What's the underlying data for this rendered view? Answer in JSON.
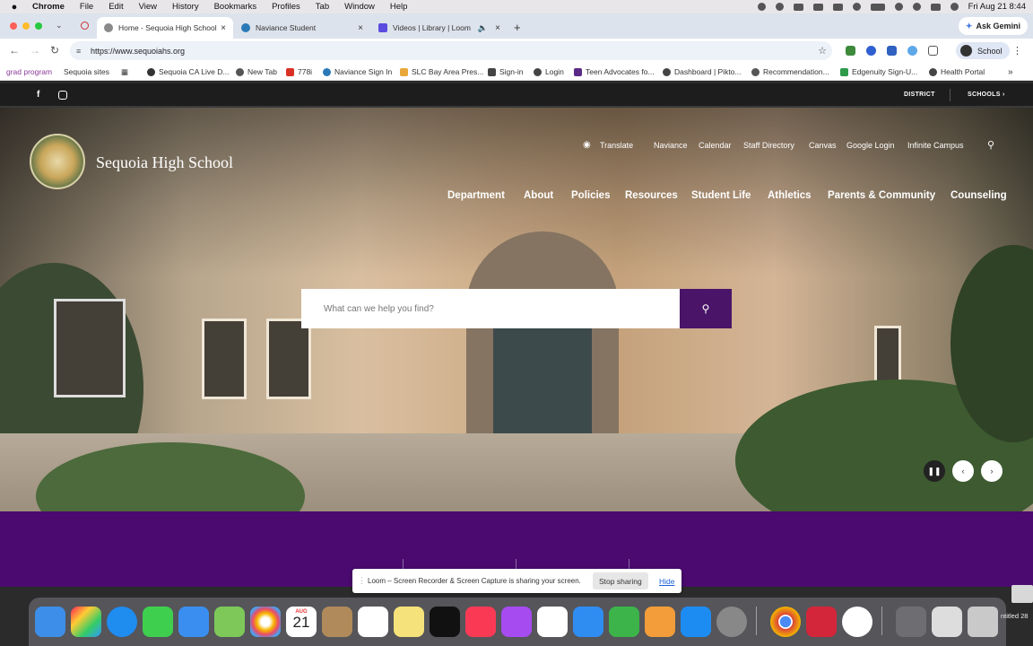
{
  "menubar": {
    "app": "Chrome",
    "items": [
      "File",
      "Edit",
      "View",
      "History",
      "Bookmarks",
      "Profiles",
      "Tab",
      "Window",
      "Help"
    ],
    "clock": "Fri Aug 21  8:44"
  },
  "tabs": [
    {
      "title": "Home - Sequoia High School",
      "color": "#8a8a8a"
    },
    {
      "title": "Naviance Student",
      "color": "#2a7ab8"
    },
    {
      "title": "Videos | Library | Loom",
      "color": "#5a4ce0"
    }
  ],
  "ask_gemini": "Ask Gemini",
  "address": {
    "url": "https://www.sequoiahs.org",
    "profile": "School"
  },
  "bookmarks": [
    {
      "label": "grad program",
      "color": "#8b3a9a",
      "textcolor": "#8b3a9a"
    },
    {
      "label": "Sequoia sites",
      "color": "",
      "textcolor": "#333"
    },
    {
      "label": "Sequoia CA Live D...",
      "color": "#333",
      "textcolor": "#333"
    },
    {
      "label": "New Tab",
      "color": "#555",
      "textcolor": "#333"
    },
    {
      "label": "778i",
      "color": "#d93025",
      "textcolor": "#333"
    },
    {
      "label": "Naviance Sign In",
      "color": "#2a7ab8",
      "textcolor": "#333"
    },
    {
      "label": "SLC Bay Area Pres...",
      "color": "#e8a93a",
      "textcolor": "#333"
    },
    {
      "label": "Sign-in",
      "color": "#444",
      "textcolor": "#333"
    },
    {
      "label": "Login",
      "color": "#444",
      "textcolor": "#333"
    },
    {
      "label": "Teen Advocates fo...",
      "color": "#5b2a86",
      "textcolor": "#333"
    },
    {
      "label": "Dashboard | Pikto...",
      "color": "#444",
      "textcolor": "#333"
    },
    {
      "label": "Recommendation...",
      "color": "#555",
      "textcolor": "#333"
    },
    {
      "label": "Edgenuity Sign-U...",
      "color": "#2e9a4a",
      "textcolor": "#333"
    },
    {
      "label": "Health Portal",
      "color": "#444",
      "textcolor": "#333"
    }
  ],
  "site": {
    "top_links": {
      "district": "DISTRICT",
      "schools": "SCHOOLS ›"
    },
    "name": "Sequoia High School",
    "utility": [
      "Translate",
      "Naviance",
      "Calendar",
      "Staff Directory",
      "Canvas",
      "Google Login",
      "Infinite Campus"
    ],
    "nav": [
      "Department",
      "About",
      "Policies",
      "Resources",
      "Student Life",
      "Athletics",
      "Parents & Community",
      "Counseling"
    ],
    "search_placeholder": "What can we help you find?",
    "purple": "#4a0a6f"
  },
  "loom": {
    "message": "Loom – Screen Recorder & Screen Capture is sharing your screen.",
    "stop": "Stop sharing",
    "hide": "Hide"
  },
  "calendar": {
    "month": "AUG",
    "day": "21"
  },
  "desktop_label": "ntitled 28"
}
